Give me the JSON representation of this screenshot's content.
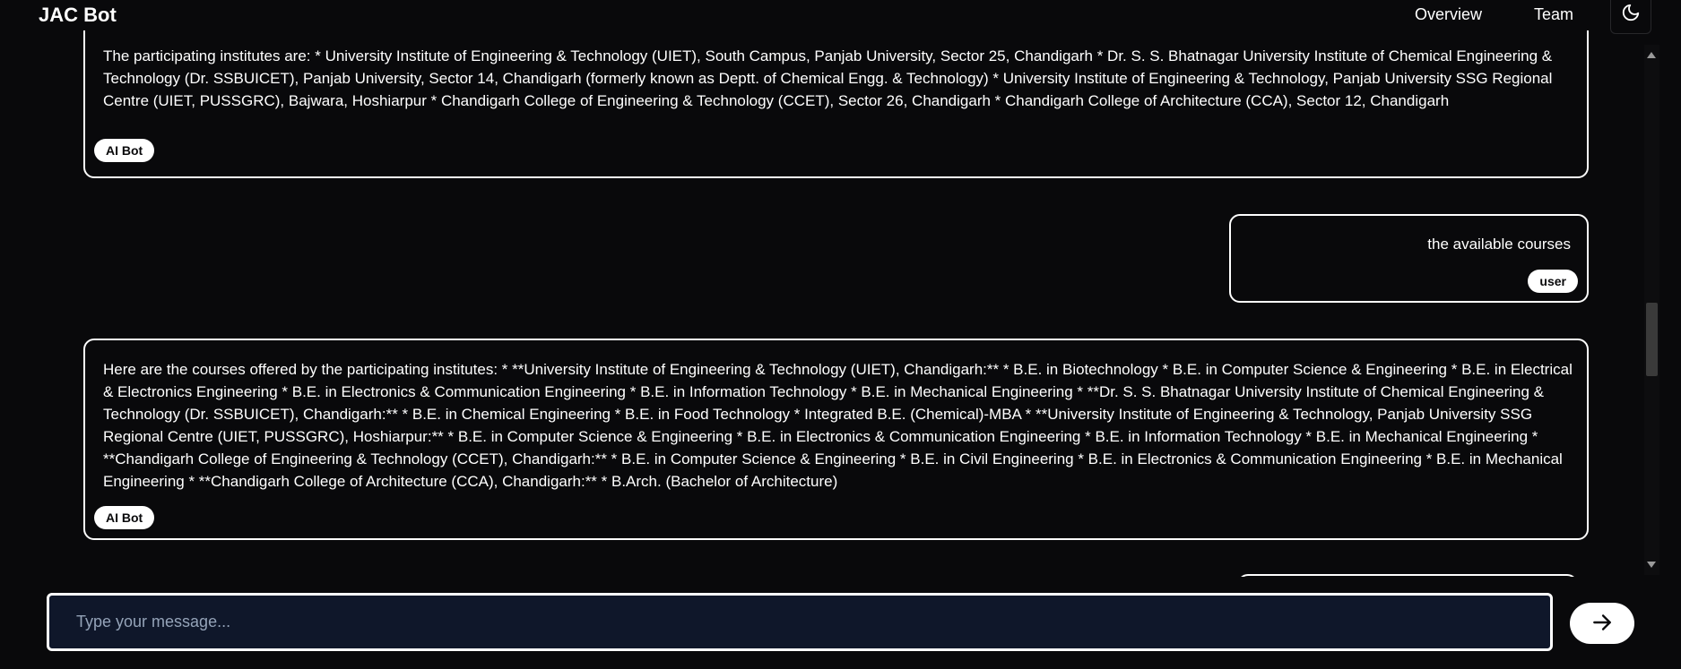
{
  "header": {
    "title": "JAC Bot",
    "nav": {
      "overview": "Overview",
      "team": "Team"
    },
    "theme_icon": "moon-icon"
  },
  "messages": [
    {
      "role": "bot",
      "text": "The participating institutes are: * University Institute of Engineering & Technology (UIET), South Campus, Panjab University, Sector 25, Chandigarh * Dr. S. S. Bhatnagar University Institute of Chemical Engineering & Technology (Dr. SSBUICET), Panjab University, Sector 14, Chandigarh (formerly known as Deptt. of Chemical Engg. & Technology) * University Institute of Engineering & Technology, Panjab University SSG Regional Centre (UIET, PUSSGRC), Bajwara, Hoshiarpur * Chandigarh College of Engineering & Technology (CCET), Sector 26, Chandigarh * Chandigarh College of Architecture (CCA), Sector 12, Chandigarh",
      "badge": "AI Bot"
    },
    {
      "role": "user",
      "text": "the available courses",
      "badge": "user"
    },
    {
      "role": "bot",
      "text": "Here are the courses offered by the participating institutes: * **University Institute of Engineering & Technology (UIET), Chandigarh:** * B.E. in Biotechnology * B.E. in Computer Science & Engineering * B.E. in Electrical & Electronics Engineering * B.E. in Electronics & Communication Engineering * B.E. in Information Technology * B.E. in Mechanical Engineering * **Dr. S. S. Bhatnagar University Institute of Chemical Engineering & Technology (Dr. SSBUICET), Chandigarh:** * B.E. in Chemical Engineering * B.E. in Food Technology * Integrated B.E. (Chemical)-MBA * **University Institute of Engineering & Technology, Panjab University SSG Regional Centre (UIET, PUSSGRC), Hoshiarpur:** * B.E. in Computer Science & Engineering * B.E. in Electronics & Communication Engineering * B.E. in Information Technology * B.E. in Mechanical Engineering * **Chandigarh College of Engineering & Technology (CCET), Chandigarh:** * B.E. in Computer Science & Engineering * B.E. in Civil Engineering * B.E. in Electronics & Communication Engineering * B.E. in Mechanical Engineering * **Chandigarh College of Architecture (CCA), Chandigarh:** * B.Arch. (Bachelor of Architecture)",
      "badge": "AI Bot"
    }
  ],
  "composer": {
    "placeholder": "Type your message...",
    "send_icon": "arrow-right-icon"
  },
  "colors": {
    "background": "#09090b",
    "bubble_border": "#ffffff",
    "input_background": "#0f172a",
    "placeholder": "#94a3b8"
  }
}
